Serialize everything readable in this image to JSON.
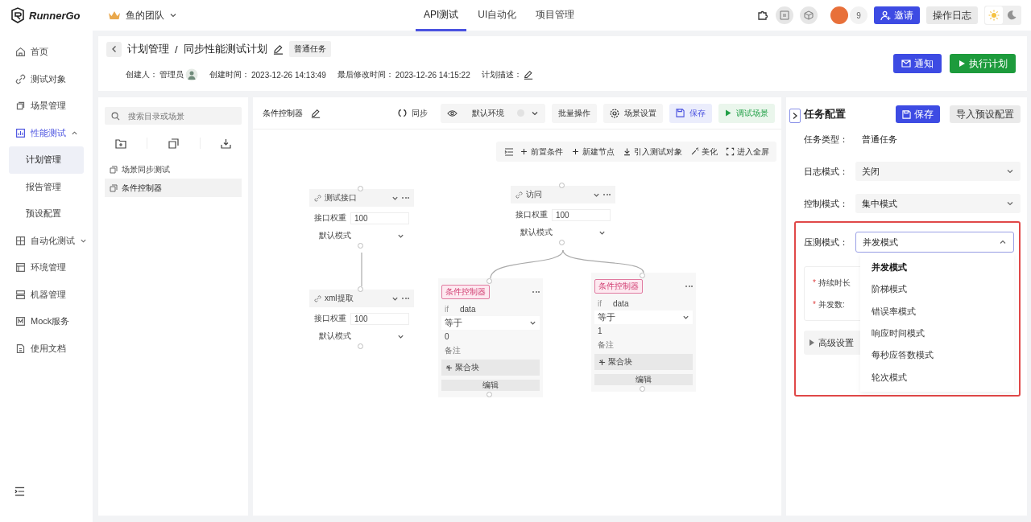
{
  "brand": {
    "name": "RunnerGo"
  },
  "team": {
    "name": "鱼的团队"
  },
  "nav_tabs": [
    {
      "label": "API测试",
      "selected": true
    },
    {
      "label": "UI自动化",
      "selected": false
    },
    {
      "label": "项目管理",
      "selected": false
    }
  ],
  "topbar": {
    "member_count": "9",
    "invite_button": "邀请",
    "log_button": "操作日志"
  },
  "theme_options": [
    {
      "kind": "light",
      "selected": true
    },
    {
      "kind": "dark",
      "selected": false
    }
  ],
  "sidebar": {
    "items": [
      {
        "label": "首页",
        "selected": false
      },
      {
        "label": "测试对象",
        "selected": false
      },
      {
        "label": "场景管理",
        "selected": false
      },
      {
        "label": "性能测试",
        "selected": true,
        "expanded": true,
        "children": [
          {
            "label": "计划管理",
            "selected": true
          },
          {
            "label": "报告管理",
            "selected": false
          },
          {
            "label": "预设配置",
            "selected": false
          }
        ]
      },
      {
        "label": "自动化测试",
        "selected": false,
        "expanded": false
      },
      {
        "label": "环境管理",
        "selected": false
      },
      {
        "label": "机器管理",
        "selected": false
      },
      {
        "label": "Mock服务",
        "selected": false
      },
      {
        "label": "使用文档",
        "selected": false
      }
    ]
  },
  "plan_header": {
    "breadcrumb": [
      "计划管理",
      "同步性能测试计划"
    ],
    "separator": "/",
    "task_tag": "普通任务",
    "meta": [
      {
        "kind": "user",
        "label": "创建人：",
        "value": "管理员"
      },
      {
        "kind": "text",
        "label": "创建时间：",
        "value": "2023-12-26 14:13:49"
      },
      {
        "kind": "text",
        "label": "最后修改时间：",
        "value": "2023-12-26 14:15:22"
      },
      {
        "kind": "edit",
        "label": "计划描述："
      }
    ],
    "notify_button": "通知",
    "run_button": "执行计划"
  },
  "scene_tree": {
    "search_placeholder": "搜索目录或场景",
    "items": [
      {
        "label": "场景同步测试",
        "selected": false
      },
      {
        "label": "条件控制器",
        "selected": true
      }
    ]
  },
  "scene_toolbar": {
    "scene_name": "条件控制器",
    "sync": "同步",
    "environment": "默认环境",
    "batch": "批量操作",
    "settings": "场景设置",
    "save": "保存",
    "debug": "调试场景"
  },
  "canvas_toolbar": [
    "前置条件",
    "新建节点",
    "引入测试对象",
    "美化",
    "进入全屏"
  ],
  "nodes": [
    {
      "kind": "api",
      "title": "测试接口",
      "weight_label": "接口权重",
      "weight": "100",
      "mode": "默认模式"
    },
    {
      "kind": "api",
      "title": "xml提取",
      "weight_label": "接口权重",
      "weight": "100",
      "mode": "默认模式"
    },
    {
      "kind": "api",
      "title": "访问",
      "weight_label": "接口权重",
      "weight": "100",
      "mode": "默认模式"
    },
    {
      "kind": "condition",
      "tag": "条件控制器",
      "keyword": "if",
      "variable": "data",
      "operator": "等于",
      "value": "0",
      "remark_placeholder": "备注",
      "aggregate": "聚合块",
      "edit": "编辑"
    },
    {
      "kind": "condition",
      "tag": "条件控制器",
      "keyword": "if",
      "variable": "data",
      "operator": "等于",
      "value": "1",
      "remark_placeholder": "备注",
      "aggregate": "聚合块",
      "edit": "编辑"
    }
  ],
  "task_config": {
    "title": "任务配置",
    "save": "保存",
    "import": "导入预设配置",
    "fields": [
      {
        "kind": "text",
        "label": "任务类型：",
        "value": "普通任务"
      },
      {
        "kind": "select",
        "label": "日志模式：",
        "value": "关闭",
        "expanded": false
      },
      {
        "kind": "select",
        "label": "控制模式：",
        "value": "集中模式",
        "expanded": false
      }
    ],
    "stress_mode": {
      "label": "压测模式：",
      "value": "并发模式",
      "expanded": true,
      "options": [
        {
          "label": "并发模式",
          "selected": true
        },
        {
          "label": "阶梯模式",
          "selected": false
        },
        {
          "label": "错误率模式",
          "selected": false
        },
        {
          "label": "响应时间模式",
          "selected": false
        },
        {
          "label": "每秒应答数模式",
          "selected": false
        },
        {
          "label": "轮次模式",
          "selected": false
        }
      ]
    },
    "params": [
      {
        "label": "持续时长",
        "required_mark": "*"
      },
      {
        "label": "并发数:",
        "required_mark": "*"
      }
    ],
    "advanced": {
      "label": "高级设置",
      "expanded": false
    }
  }
}
